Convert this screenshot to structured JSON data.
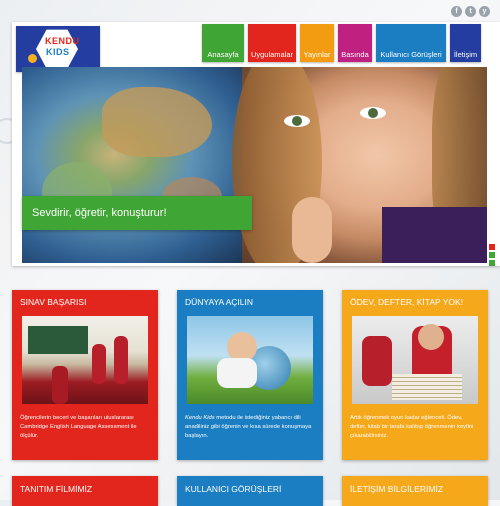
{
  "logo": {
    "line1": "KENDU",
    "line2": "KIDS"
  },
  "social": [
    "f",
    "t",
    "y"
  ],
  "nav": [
    {
      "label": "Anasayfa",
      "color": "#3fa535"
    },
    {
      "label": "Uygulamalar",
      "color": "#e2261d"
    },
    {
      "label": "Yayınlar",
      "color": "#f39c12"
    },
    {
      "label": "Basında",
      "color": "#c0207f"
    },
    {
      "label": "Kullanıcı Görüşleri",
      "color": "#1b7ec2"
    },
    {
      "label": "İletişim",
      "color": "#233da0"
    }
  ],
  "hero": {
    "slogan": "Sevdirir, öğretir, konuşturur!"
  },
  "cards": [
    {
      "title": "SINAV BAŞARISI",
      "color": "#e2261d",
      "text": "Öğrencilerin beceri ve başarıları uluslararası Cambridge English Language Assessment ile ölçülür."
    },
    {
      "title": "DÜNYAYA AÇILIN",
      "color": "#1b7ec2",
      "text_em": "Kendu Kids",
      "text": " metodu ile istediğiniz yabancı dili anadiliniz gibi öğrenin ve kısa sürede konuşmaya başlayın."
    },
    {
      "title": "ÖDEV, DEFTER, KİTAP YOK!",
      "color": "#f6a81b",
      "text": "Artık öğrenmek oyun kadar eğlenceli. Ödev, defter, kitab bir tarafa kalıbıp öğrenmenin keyfini çıkarabilirsiniz."
    }
  ],
  "footer_cards": [
    {
      "title": "TANITIM FİLMİMİZ",
      "color": "#e2261d"
    },
    {
      "title": "KULLANICI GÖRÜŞLERİ",
      "color": "#1b7ec2"
    },
    {
      "title": "İLETİŞİM BİLGİLERİMİZ",
      "color": "#f6a81b"
    }
  ],
  "slider_dots": [
    "#e2261d",
    "#3fa535",
    "#3fa535"
  ]
}
